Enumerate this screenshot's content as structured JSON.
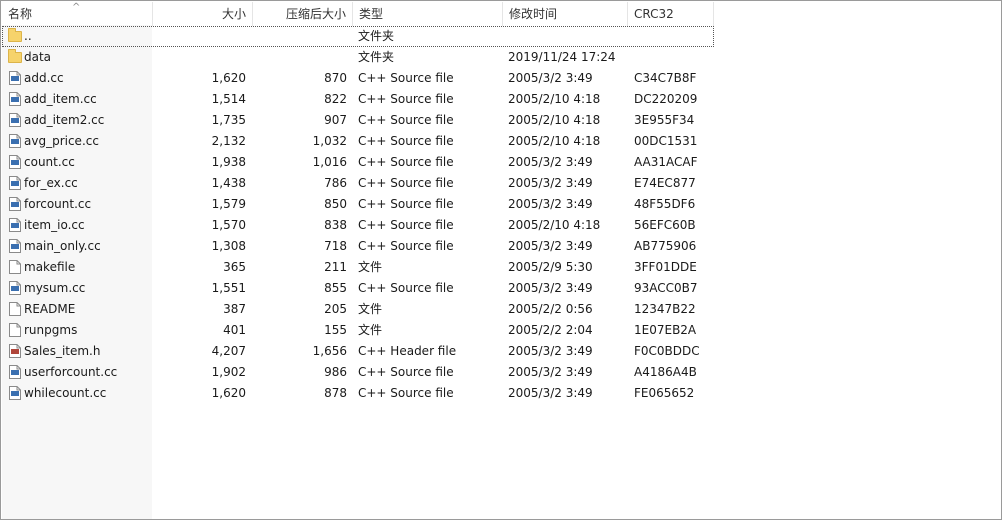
{
  "columns": {
    "name": "名称",
    "size": "大小",
    "compressed": "压缩后大小",
    "type": "类型",
    "modified": "修改时间",
    "crc": "CRC32"
  },
  "sort_indicator": "^",
  "files": [
    {
      "name": "..",
      "size": "",
      "compressed": "",
      "type": "文件夹",
      "modified": "",
      "crc": "",
      "icon": "folder-icon"
    },
    {
      "name": "data",
      "size": "",
      "compressed": "",
      "type": "文件夹",
      "modified": "2019/11/24 17:24",
      "crc": "",
      "icon": "folder-icon"
    },
    {
      "name": "add.cc",
      "size": "1,620",
      "compressed": "870",
      "type": "C++ Source file",
      "modified": "2005/3/2 3:49",
      "crc": "C34C7B8F",
      "icon": "cpp-source-icon"
    },
    {
      "name": "add_item.cc",
      "size": "1,514",
      "compressed": "822",
      "type": "C++ Source file",
      "modified": "2005/2/10 4:18",
      "crc": "DC220209",
      "icon": "cpp-source-icon"
    },
    {
      "name": "add_item2.cc",
      "size": "1,735",
      "compressed": "907",
      "type": "C++ Source file",
      "modified": "2005/2/10 4:18",
      "crc": "3E955F34",
      "icon": "cpp-source-icon"
    },
    {
      "name": "avg_price.cc",
      "size": "2,132",
      "compressed": "1,032",
      "type": "C++ Source file",
      "modified": "2005/2/10 4:18",
      "crc": "00DC1531",
      "icon": "cpp-source-icon"
    },
    {
      "name": "count.cc",
      "size": "1,938",
      "compressed": "1,016",
      "type": "C++ Source file",
      "modified": "2005/3/2 3:49",
      "crc": "AA31ACAF",
      "icon": "cpp-source-icon"
    },
    {
      "name": "for_ex.cc",
      "size": "1,438",
      "compressed": "786",
      "type": "C++ Source file",
      "modified": "2005/3/2 3:49",
      "crc": "E74EC877",
      "icon": "cpp-source-icon"
    },
    {
      "name": "forcount.cc",
      "size": "1,579",
      "compressed": "850",
      "type": "C++ Source file",
      "modified": "2005/3/2 3:49",
      "crc": "48F55DF6",
      "icon": "cpp-source-icon"
    },
    {
      "name": "item_io.cc",
      "size": "1,570",
      "compressed": "838",
      "type": "C++ Source file",
      "modified": "2005/2/10 4:18",
      "crc": "56EFC60B",
      "icon": "cpp-source-icon"
    },
    {
      "name": "main_only.cc",
      "size": "1,308",
      "compressed": "718",
      "type": "C++ Source file",
      "modified": "2005/3/2 3:49",
      "crc": "AB775906",
      "icon": "cpp-source-icon"
    },
    {
      "name": "makefile",
      "size": "365",
      "compressed": "211",
      "type": "文件",
      "modified": "2005/2/9 5:30",
      "crc": "3FF01DDE",
      "icon": "file-icon"
    },
    {
      "name": "mysum.cc",
      "size": "1,551",
      "compressed": "855",
      "type": "C++ Source file",
      "modified": "2005/3/2 3:49",
      "crc": "93ACC0B7",
      "icon": "cpp-source-icon"
    },
    {
      "name": "README",
      "size": "387",
      "compressed": "205",
      "type": "文件",
      "modified": "2005/2/2 0:56",
      "crc": "12347B22",
      "icon": "file-icon"
    },
    {
      "name": "runpgms",
      "size": "401",
      "compressed": "155",
      "type": "文件",
      "modified": "2005/2/2 2:04",
      "crc": "1E07EB2A",
      "icon": "file-icon"
    },
    {
      "name": "Sales_item.h",
      "size": "4,207",
      "compressed": "1,656",
      "type": "C++ Header file",
      "modified": "2005/3/2 3:49",
      "crc": "F0C0BDDC",
      "icon": "cpp-header-icon"
    },
    {
      "name": "userforcount.cc",
      "size": "1,902",
      "compressed": "986",
      "type": "C++ Source file",
      "modified": "2005/3/2 3:49",
      "crc": "A4186A4B",
      "icon": "cpp-source-icon"
    },
    {
      "name": "whilecount.cc",
      "size": "1,620",
      "compressed": "878",
      "type": "C++ Source file",
      "modified": "2005/3/2 3:49",
      "crc": "FE065652",
      "icon": "cpp-source-icon"
    }
  ]
}
